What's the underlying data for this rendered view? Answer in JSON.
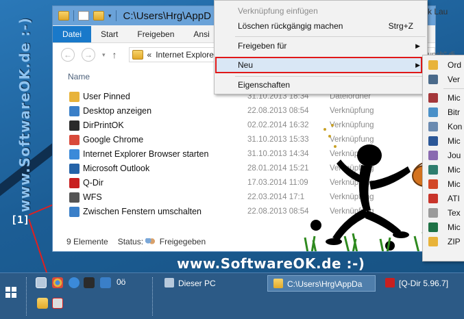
{
  "side_watermark": "www.SoftwareOK.de :-)",
  "marker": "[1]",
  "window": {
    "title": "C:\\Users\\Hrg\\AppD",
    "tabs": [
      "Datei",
      "Start",
      "Freigeben",
      "Ansi"
    ],
    "address": "Internet Explorer",
    "address_prefix": "«",
    "column_name": "Name",
    "files": [
      {
        "name": "User Pinned",
        "date": "31.10.2013 18:34",
        "type": "Dateiordner",
        "icon": "folder-icon",
        "color": "#e8b33a"
      },
      {
        "name": "Desktop anzeigen",
        "date": "22.08.2013 08:54",
        "type": "Verknüpfung",
        "icon": "desktop-icon",
        "color": "#3a7fc8"
      },
      {
        "name": "DirPrintOK",
        "date": "02.02.2014 16:32",
        "type": "Verknüpfung",
        "icon": "printer-icon",
        "color": "#2b2b2b"
      },
      {
        "name": "Google Chrome",
        "date": "31.10.2013 15:33",
        "type": "Verknüpfung",
        "icon": "chrome-icon",
        "color": "#d94a3b"
      },
      {
        "name": "Internet Explorer Browser starten",
        "date": "31.10.2013 14:34",
        "type": "Verknüpfung",
        "icon": "ie-icon",
        "color": "#3b8ad9"
      },
      {
        "name": "Microsoft Outlook",
        "date": "28.01.2014 15:21",
        "type": "Verknüpfung",
        "icon": "outlook-icon",
        "color": "#2463a8"
      },
      {
        "name": "Q-Dir",
        "date": "17.03.2014 11:09",
        "type": "Verknüpfung",
        "icon": "qdir-icon",
        "color": "#c82020"
      },
      {
        "name": "WFS",
        "date": "22.03.2014 17:1",
        "type": "Verknüpfung",
        "icon": "wfs-icon",
        "color": "#555555"
      },
      {
        "name": "Zwischen Fenstern umschalten",
        "date": "22.08.2013 08:54",
        "type": "Verknüpfung",
        "icon": "switch-windows-icon",
        "color": "#3a7fc8"
      }
    ],
    "status_count": "9 Elemente",
    "status_label": "Status:",
    "status_value": "Freigegeben"
  },
  "context_menu": {
    "items": [
      {
        "label": "Verknüpfung einfügen",
        "shortcut": "",
        "disabled": true
      },
      {
        "label": "Löschen rückgängig machen",
        "shortcut": "Strg+Z",
        "disabled": false
      },
      {
        "label": "Freigeben für",
        "submenu": true
      },
      {
        "label": "Neu",
        "submenu": true,
        "highlighted": true
      },
      {
        "label": "Eigenschaften",
        "shortcut": ""
      }
    ]
  },
  "submenu_new": {
    "items": [
      {
        "label": "Ord",
        "icon": "folder-icon",
        "color": "#e8b33a"
      },
      {
        "label": "Ver",
        "icon": "shortcut-icon",
        "color": "#4a6a8a"
      },
      {
        "label": "Mic",
        "icon": "access-icon",
        "color": "#a4373a"
      },
      {
        "label": "Bitr",
        "icon": "bitmap-icon",
        "color": "#4a90c8"
      },
      {
        "label": "Kon",
        "icon": "contact-icon",
        "color": "#6a8ab0"
      },
      {
        "label": "Mic",
        "icon": "word-icon",
        "color": "#2b5797"
      },
      {
        "label": "Jou",
        "icon": "journal-icon",
        "color": "#8a6ab0"
      },
      {
        "label": "Mic",
        "icon": "publisher-icon",
        "color": "#2e7d6e"
      },
      {
        "label": "Mic",
        "icon": "powerpoint-icon",
        "color": "#d24726"
      },
      {
        "label": "ATI",
        "icon": "ati-icon",
        "color": "#c8342a"
      },
      {
        "label": "Tex",
        "icon": "text-icon",
        "color": "#9a9a9a"
      },
      {
        "label": "Mic",
        "icon": "excel-icon",
        "color": "#1e7145"
      },
      {
        "label": "ZIP",
        "icon": "zip-icon",
        "color": "#e8b33a"
      }
    ]
  },
  "fragment_right": "k Lau",
  "fragment_right2": "unch\" di",
  "brand": "www.SoftwareOK.de :-)",
  "taskbar": {
    "tasks": [
      {
        "label": "Dieser PC",
        "active": false
      },
      {
        "label": "C:\\Users\\Hrg\\AppDa",
        "active": true
      },
      {
        "label": "[Q-Dir 5.96.7]",
        "active": false
      }
    ],
    "ql_text": "0ö"
  }
}
